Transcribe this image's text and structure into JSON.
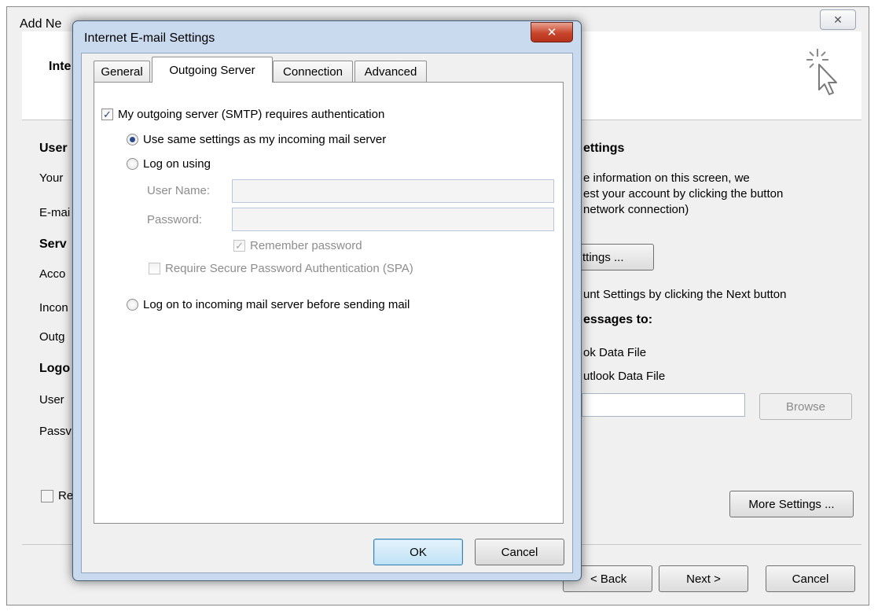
{
  "background_dialog": {
    "title": "Add Ne",
    "header_title": "Inte",
    "left_labels": [
      "User",
      "Your",
      "E-mai",
      "Serv",
      "Acco",
      "Incon",
      "Outg",
      "Logo",
      "User",
      "Passv"
    ],
    "remember_partial": "Re",
    "right_section_title": "ettings",
    "right_info_line1": "e information on this screen, we",
    "right_info_line2": "est your account by clicking the button",
    "right_info_line3": "network connection)",
    "test_button_partial": "ttings ...",
    "next_hint": "unt Settings by clicking the Next button",
    "deliver_title": "essages to:",
    "option_new_data_file": "ok Data File",
    "option_existing_data_file": "utlook Data File",
    "browse_button": "Browse",
    "more_settings_button": "More Settings ...",
    "back_button": "< Back",
    "next_button": "Next >",
    "cancel_button": "Cancel",
    "close_glyph": "✕"
  },
  "email_settings_dialog": {
    "title": "Internet E-mail Settings",
    "close_glyph": "✕",
    "tabs": [
      {
        "label": "General",
        "active": false
      },
      {
        "label": "Outgoing Server",
        "active": true
      },
      {
        "label": "Connection",
        "active": false
      },
      {
        "label": "Advanced",
        "active": false
      }
    ],
    "smtp_auth_label": "My outgoing server (SMTP) requires authentication",
    "smtp_auth_checked": true,
    "radio_same_settings": "Use same settings as my incoming mail server",
    "radio_log_on_using": "Log on using",
    "user_name_label": "User Name:",
    "user_name_value": "",
    "password_label": "Password:",
    "password_value": "",
    "remember_password_label": "Remember password",
    "remember_password_checked": true,
    "spa_label": "Require Secure Password Authentication (SPA)",
    "spa_checked": false,
    "radio_log_on_incoming": "Log on to incoming mail server before sending mail",
    "selected_radio": "radio_same_settings",
    "ok_button": "OK",
    "cancel_button": "Cancel"
  },
  "colors": {
    "dialog_frame": "#c9d9ee",
    "close_button_red": "#c9452c",
    "radio_dot": "#2b4a8e",
    "default_button": "#bfe2f7"
  }
}
